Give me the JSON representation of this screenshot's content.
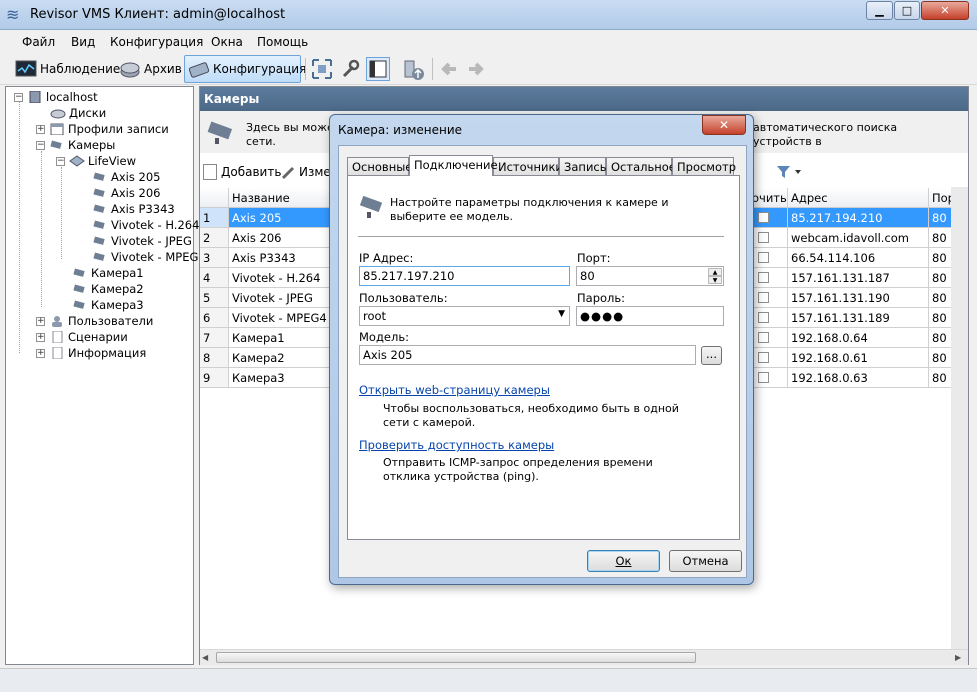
{
  "window": {
    "title": "Revisor VMS Клиент: admin@localhost"
  },
  "menu": [
    "Файл",
    "Вид",
    "Конфигурация",
    "Окна",
    "Помощь"
  ],
  "toolbar": {
    "monitoring": "Наблюдение",
    "archive": "Архив",
    "config": "Конфигурация"
  },
  "tree": {
    "root": "localhost",
    "disks": "Диски",
    "profiles": "Профили записи",
    "cameras": "Камеры",
    "group": "LifeView",
    "group_items": [
      "Axis 205",
      "Axis 206",
      "Axis P3343",
      "Vivotek - H.264",
      "Vivotek - JPEG",
      "Vivotek - MPEG4"
    ],
    "other_cams": [
      "Камера1",
      "Камера2",
      "Камера3"
    ],
    "users": "Пользователи",
    "scenarios": "Сценарии",
    "info": "Информация"
  },
  "panel": {
    "header": "Камеры",
    "info_left": "Здесь вы може",
    "info_left2": "сети.",
    "info_right": "автоматического поиска устройств в",
    "add": "Добавить",
    "edit": "Изме"
  },
  "grid": {
    "headers": {
      "name": "Название",
      "partial": "очить",
      "address": "Адрес",
      "port": "Порт"
    },
    "rows": [
      {
        "n": "1",
        "name": "Axis 205",
        "address": "85.217.194.210",
        "port": "80"
      },
      {
        "n": "2",
        "name": "Axis 206",
        "address": "webcam.idavoll.com",
        "port": "80"
      },
      {
        "n": "3",
        "name": "Axis P3343",
        "address": "66.54.114.106",
        "port": "80"
      },
      {
        "n": "4",
        "name": "Vivotek - H.264",
        "address": "157.161.131.187",
        "port": "80"
      },
      {
        "n": "5",
        "name": "Vivotek - JPEG",
        "address": "157.161.131.190",
        "port": "80"
      },
      {
        "n": "6",
        "name": "Vivotek - MPEG4",
        "address": "157.161.131.189",
        "port": "80"
      },
      {
        "n": "7",
        "name": "Камера1",
        "address": "192.168.0.64",
        "port": "80"
      },
      {
        "n": "8",
        "name": "Камера2",
        "address": "192.168.0.61",
        "port": "80"
      },
      {
        "n": "9",
        "name": "Камера3",
        "address": "192.168.0.63",
        "port": "80"
      }
    ]
  },
  "dialog": {
    "title": "Камера: изменение",
    "tabs": [
      "Основные",
      "Подключение",
      "Источники",
      "Запись",
      "Остальное",
      "Просмотр"
    ],
    "intro": "Настройте параметры подключения к камере и выберите ее модель.",
    "ip_label": "IP Адрес:",
    "ip_value": "85.217.197.210",
    "port_label": "Порт:",
    "port_value": "80",
    "user_label": "Пользователь:",
    "user_value": "root",
    "pass_label": "Пароль:",
    "pass_value": "●●●●",
    "model_label": "Модель:",
    "model_value": "Axis 205",
    "browse": "...",
    "link_web": "Открыть web-страницу камеры",
    "note_web": "Чтобы воспользоваться, необходимо быть в одной сети с камерой.",
    "link_ping": "Проверить доступность камеры",
    "note_ping": "Отправить ICMP-запрос определения времени отклика устройства (ping).",
    "ok": "Ок",
    "cancel": "Отмена"
  }
}
